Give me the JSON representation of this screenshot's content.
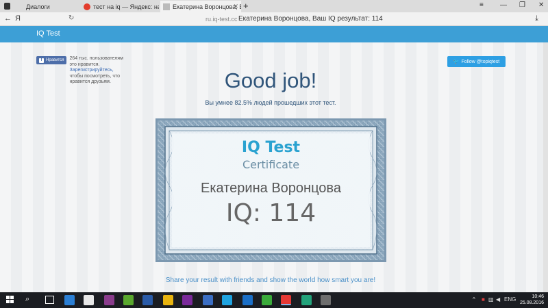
{
  "browser": {
    "tabs": [
      {
        "label": "Диалоги",
        "active": false
      },
      {
        "label": "тест на iq — Яндекс: нашло",
        "active": false
      },
      {
        "label": "Екатерина Воронцова, Ва",
        "active": true
      }
    ],
    "new_tab_glyph": "+",
    "url": "ru.iq-test.cc",
    "page_title": "Екатерина Воронцова, Ваш IQ результат: 114",
    "logo_glyph": "Я"
  },
  "site": {
    "logo": "IQ Test"
  },
  "facebook": {
    "button_label": "Нравится",
    "text_before_link": "264 тыс. пользователям это нравится.",
    "link_text": "Зарегистрируйтесь,",
    "text_after_link": "чтобы посмотреть, что нравится друзьям."
  },
  "twitter": {
    "label": "Follow @topiqtest"
  },
  "main": {
    "headline": "Good job!",
    "subline": "Вы умнее 82.5% людей прошедших этот тест."
  },
  "certificate": {
    "title": "IQ Test",
    "subtitle": "Certificate",
    "name": "Екатерина Воронцова",
    "score": "IQ: 114"
  },
  "share": {
    "text": "Share your result with friends and show the world how smart you are!"
  },
  "taskbar": {
    "language": "ENG",
    "time": "10:46",
    "date": "25.08.2016",
    "apps": [
      "edge-icon",
      "store-icon",
      "winrar-icon",
      "green-app-icon",
      "photoshop-icon",
      "chrome-icon",
      "tor-icon",
      "vk-icon",
      "skype-icon",
      "teamviewer-icon",
      "utorrent-icon",
      "yandex-browser-icon",
      "camtasia-icon",
      "gimp-icon"
    ]
  },
  "colors": {
    "site_header": "#3d9fd6",
    "headline": "#30557a",
    "certificate_title": "#2aa2d0",
    "twitter": "#2d9fe3",
    "facebook": "#4d6ea9",
    "share_text": "#4a90c8",
    "taskbar": "#1b1d22"
  }
}
